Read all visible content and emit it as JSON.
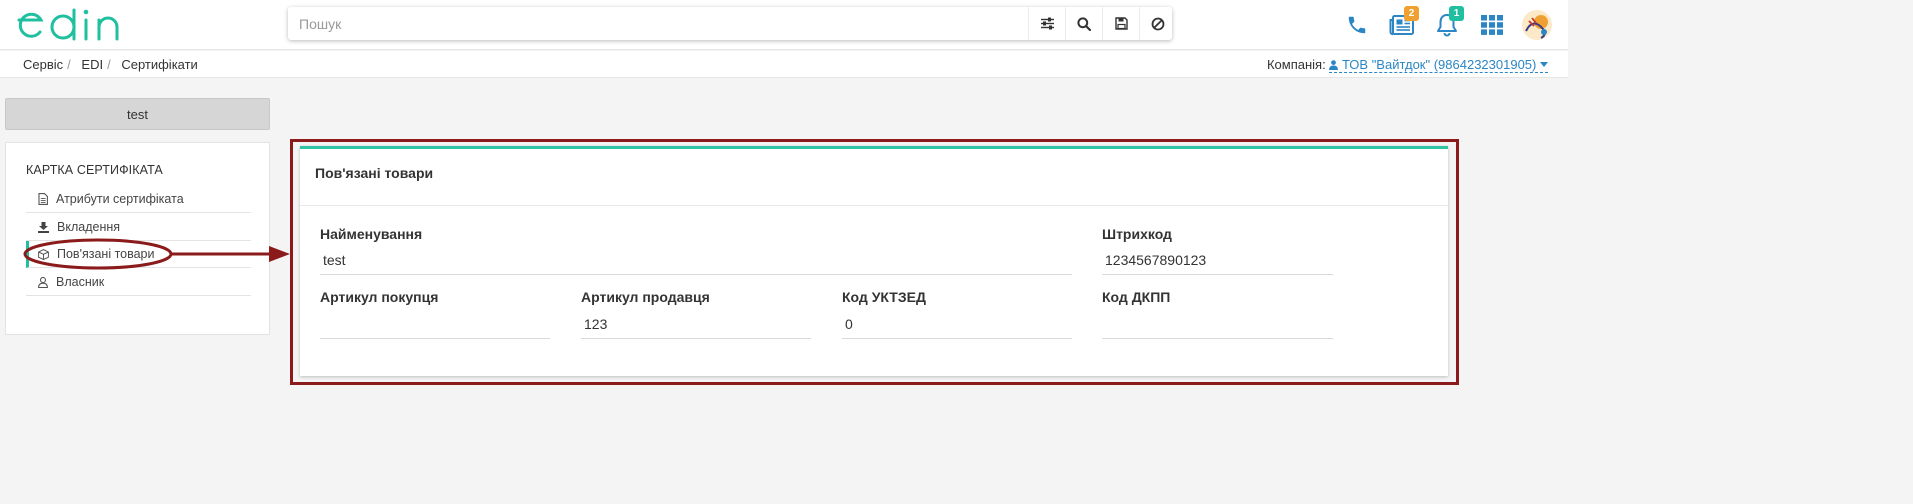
{
  "header": {
    "logo_text": "edin",
    "search": {
      "placeholder": "Пошук",
      "value": ""
    },
    "notifications": {
      "news_badge": "2",
      "bell_badge": "1"
    }
  },
  "breadcrumb": [
    "Сервіс",
    "EDI",
    "Сертифікати"
  ],
  "company": {
    "label": "Компанія:",
    "name": "ТОВ \"Вайтдок\" (9864232301905)"
  },
  "sidebar": {
    "top_button": "test",
    "title": "КАРТКА СЕРТИФІКАТА",
    "items": [
      {
        "label": "Атрибути сертифіката",
        "icon": "document-icon"
      },
      {
        "label": "Вкладення",
        "icon": "download-icon"
      },
      {
        "label": "Пов'язані товари",
        "icon": "box-icon",
        "active": true
      },
      {
        "label": "Власник",
        "icon": "user-icon"
      }
    ]
  },
  "panel": {
    "title": "Пов'язані товари",
    "fields": {
      "name": {
        "label": "Найменування",
        "value": "test"
      },
      "barcode": {
        "label": "Штрихкод",
        "value": "1234567890123"
      },
      "buyer_article": {
        "label": "Артикул покупця",
        "value": ""
      },
      "seller_article": {
        "label": "Артикул продавця",
        "value": "123"
      },
      "uktzed": {
        "label": "Код УКТЗЕД",
        "value": "0"
      },
      "dkpp": {
        "label": "Код ДКПП",
        "value": ""
      }
    }
  },
  "colors": {
    "accent": "#2fc4a3",
    "link": "#2b86c5",
    "annotation": "#8b1a1a",
    "badge_orange": "#f0a030",
    "badge_green": "#1fbf9f"
  }
}
